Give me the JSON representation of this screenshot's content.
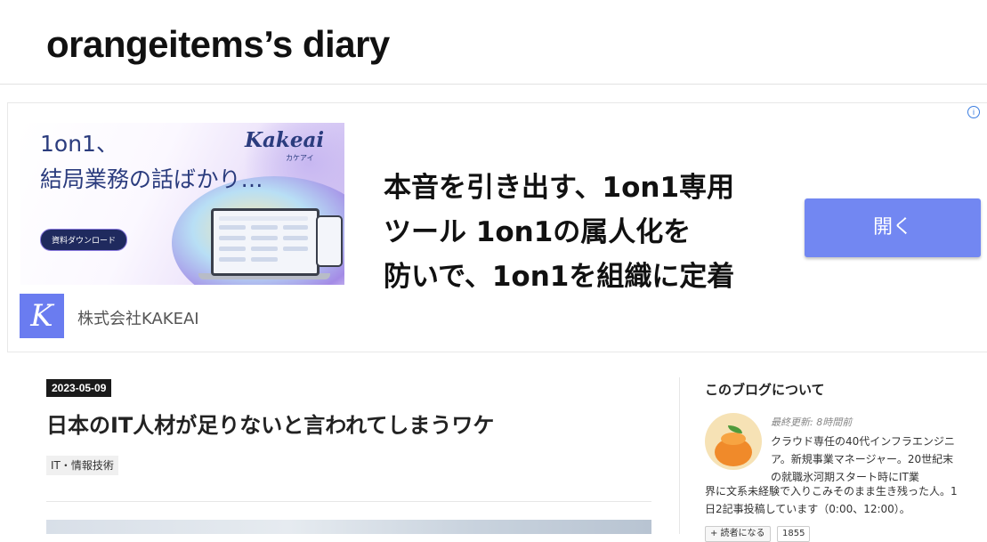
{
  "header": {
    "blog_title": "orangeitems’s diary"
  },
  "ad": {
    "info_icon": "info-icon",
    "close_icon": "close-icon",
    "image": {
      "line1": "1on1、",
      "line2": "結局業務の話ばかり…",
      "logo": "Kakeai",
      "logo_sub": "カケアイ",
      "cta": "資料ダウンロード"
    },
    "headline": [
      "本音を引き出す、1on1専用",
      "ツール 1on1の属人化を",
      "防いで、1on1を組織に定着"
    ],
    "open_button": "開く",
    "brand_logo_letter": "K",
    "company": "株式会社KAKEAI",
    "colors": {
      "button": "#7287f2",
      "logo_bg": "#6a7cf0"
    }
  },
  "post": {
    "date": "2023-05-09",
    "title": "日本のIT人材が足りないと言われてしまうワケ",
    "category": "IT・情報技術"
  },
  "sidebar": {
    "title": "このブログについて",
    "updated": "最終更新: 8時間前",
    "desc1": "クラウド専任の40代インフラエンジニア。新規事業マネージャー。20世紀末の就職氷河期スタート時にIT業",
    "desc2": "界に文系未経験で入りこみそのまま生き残った人。1日2記事投稿しています（0:00、12:00）。",
    "reader_button": "+ 読者になる",
    "reader_count": "1855"
  }
}
